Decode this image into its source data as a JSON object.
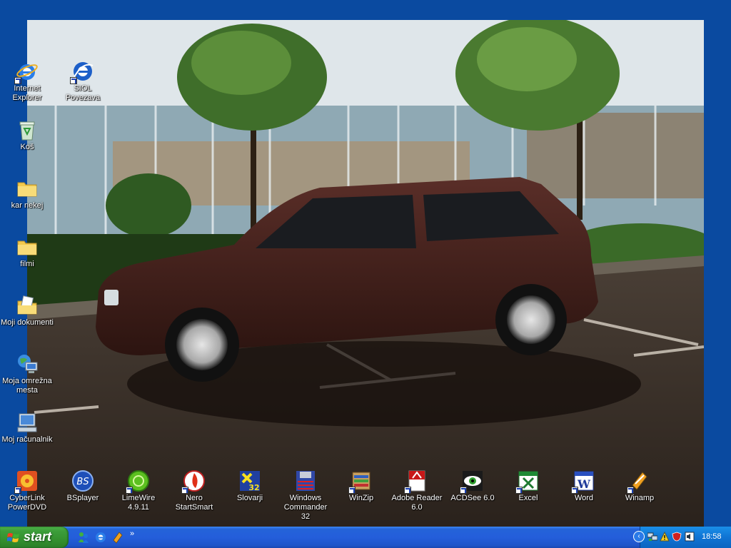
{
  "desktop": {
    "icons": [
      {
        "label": "Internet Explorer",
        "icon": "internet-explorer-icon"
      },
      {
        "label": "SIOL Povezava",
        "icon": "siol-connection-icon"
      },
      {
        "label": "Koš",
        "icon": "recycle-bin-icon"
      },
      {
        "label": "kar nekej",
        "icon": "folder-icon"
      },
      {
        "label": "filmi",
        "icon": "folder-icon"
      },
      {
        "label": "Moji dokumenti",
        "icon": "my-documents-icon"
      },
      {
        "label": "Moja omrežna mesta",
        "icon": "network-places-icon"
      },
      {
        "label": "Moj računalnik",
        "icon": "my-computer-icon"
      },
      {
        "label": "CyberLink PowerDVD",
        "icon": "powerdvd-icon"
      },
      {
        "label": "BSplayer",
        "icon": "bsplayer-icon"
      },
      {
        "label": "LimeWire 4.9.11",
        "icon": "limewire-icon"
      },
      {
        "label": "Nero StartSmart",
        "icon": "nero-icon"
      },
      {
        "label": "Slovarji",
        "icon": "slovarji-icon"
      },
      {
        "label": "Windows Commander 32",
        "icon": "windows-commander-icon"
      },
      {
        "label": "WinZip",
        "icon": "winzip-icon"
      },
      {
        "label": "Adobe Reader 6.0",
        "icon": "adobe-reader-icon"
      },
      {
        "label": "ACDSee 6.0",
        "icon": "acdsee-icon"
      },
      {
        "label": "Excel",
        "icon": "excel-icon"
      },
      {
        "label": "Word",
        "icon": "word-icon"
      },
      {
        "label": "Winamp",
        "icon": "winamp-icon"
      }
    ]
  },
  "taskbar": {
    "start_label": "start",
    "quick_launch_more": "»",
    "clock": "18:58",
    "tray_expand": "‹"
  },
  "colors": {
    "desktop_bg": "#0a4aa0",
    "taskbar_blue": "#245edb",
    "start_green": "#3c9e3a",
    "tray_blue": "#0f74d4"
  }
}
